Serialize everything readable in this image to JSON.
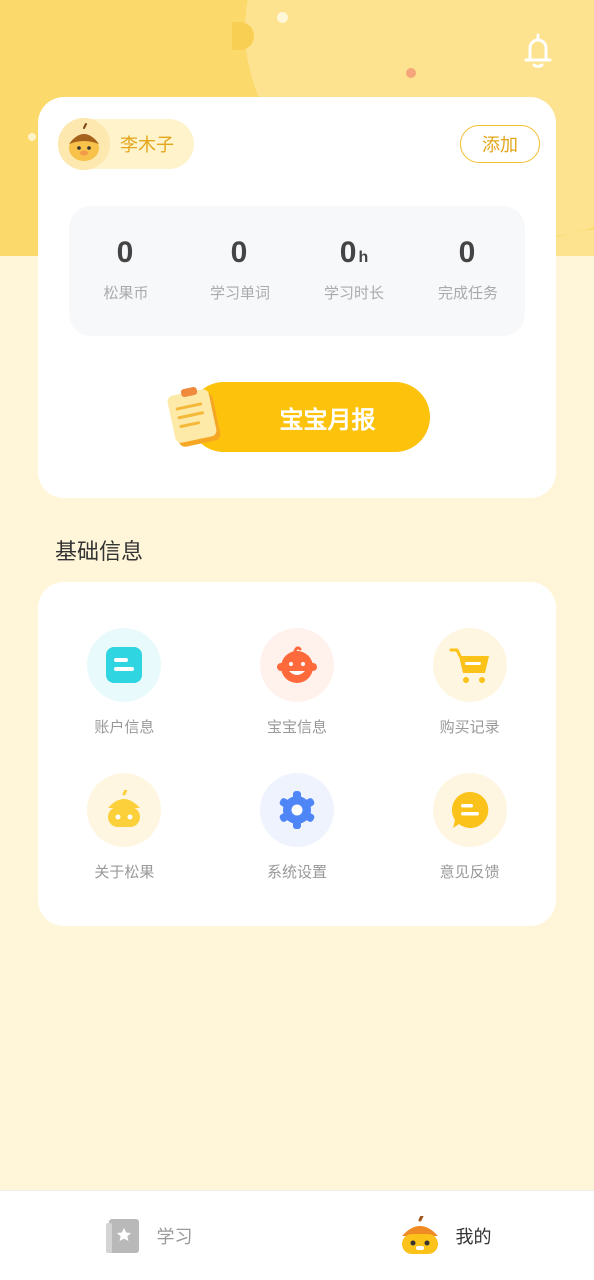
{
  "user": {
    "name": "李木子",
    "add_label": "添加"
  },
  "stats": [
    {
      "value": "0",
      "unit": "",
      "label": "松果币"
    },
    {
      "value": "0",
      "unit": "",
      "label": "学习单词"
    },
    {
      "value": "0",
      "unit": "h",
      "label": "学习时长"
    },
    {
      "value": "0",
      "unit": "",
      "label": "完成任务"
    }
  ],
  "report_button": "宝宝月报",
  "section_title": "基础信息",
  "menu": [
    {
      "label": "账户信息",
      "icon": "account-icon"
    },
    {
      "label": "宝宝信息",
      "icon": "baby-icon"
    },
    {
      "label": "购买记录",
      "icon": "cart-icon"
    },
    {
      "label": "关于松果",
      "icon": "pinecone-icon"
    },
    {
      "label": "系统设置",
      "icon": "gear-icon"
    },
    {
      "label": "意见反馈",
      "icon": "feedback-icon"
    }
  ],
  "tabs": [
    {
      "label": "学习",
      "icon": "book-icon",
      "active": false
    },
    {
      "label": "我的",
      "icon": "pinecone-face-icon",
      "active": true
    }
  ],
  "colors": {
    "header_yellow": "#fbd96b",
    "page_bg": "#fff6da",
    "accent": "#fcc20c",
    "name_text": "#e3a51a"
  }
}
